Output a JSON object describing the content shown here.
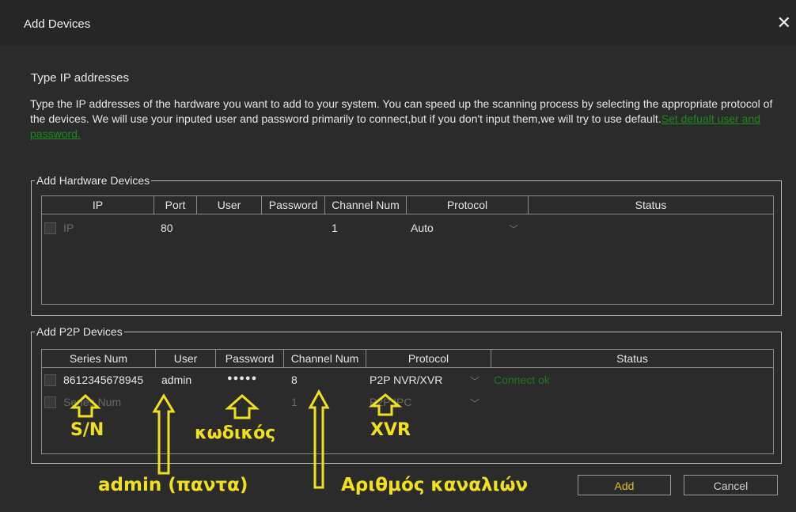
{
  "window": {
    "title": "Add Devices",
    "close_glyph": "✕"
  },
  "section_title": "Type IP addresses",
  "description": {
    "text": "Type the IP addresses of the hardware you want to add to your system. You can speed up the scanning process by selecting the appropriate protocol of the devices. We will use your inputed user and password primarily to connect,but if you don't input them,we will try to use default.",
    "link": "Set defualt user and password."
  },
  "hardware": {
    "group_label": "Add Hardware Devices",
    "headers": [
      "IP",
      "Port",
      "User",
      "Password",
      "Channel Num",
      "Protocol",
      "Status"
    ],
    "row": {
      "ip": "IP",
      "port": "80",
      "channel": "1",
      "protocol": "Auto"
    }
  },
  "p2p": {
    "group_label": "Add P2P Devices",
    "headers": [
      "Series Num",
      "User",
      "Password",
      "Channel Num",
      "Protocol",
      "Status"
    ],
    "rows": [
      {
        "series": "8612345678945",
        "user": "admin",
        "password": "●●●●●",
        "channel": "8",
        "protocol": "P2P NVR/XVR",
        "status": "Connect ok"
      },
      {
        "series": "Series Num",
        "user": "",
        "password": "",
        "channel": "1",
        "protocol": "P2P IPC",
        "status": ""
      }
    ]
  },
  "buttons": {
    "add": "Add",
    "cancel": "Cancel"
  },
  "annotations": {
    "sn": "S/N",
    "password": "κωδικός",
    "xvr": "XVR",
    "admin": "admin  (παντα)",
    "channels": "Αριθμός καναλιών",
    "color": "#f0e020"
  }
}
